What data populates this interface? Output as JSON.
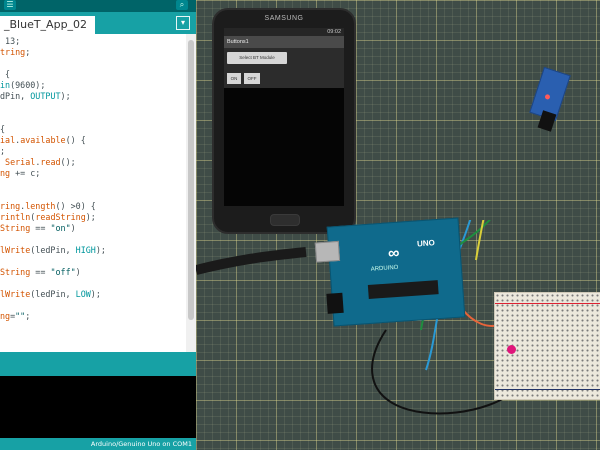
{
  "ide": {
    "toolbar": {
      "serial_monitor_icon": "magnifier-icon"
    },
    "tab": {
      "label": "_BlueT_App_02"
    },
    "tab_menu": "▾",
    "code_lines": [
      " 13;",
      "tring;",
      "",
      " {",
      "in(9600);",
      "dPin, OUTPUT);",
      "",
      "",
      "{",
      "ial.available() {",
      ";",
      " Serial.read();",
      "ng += c;",
      "",
      "",
      "ring.length() >0) {",
      "rintln(readString);",
      "String == \"on\")",
      "",
      "lWrite(ledPin, HIGH);",
      "",
      "String == \"off\")",
      "",
      "lWrite(ledPin, LOW);",
      "",
      "ng=\"\";"
    ],
    "status_bar": "Arduino/Genuino Uno on COM1"
  },
  "phone": {
    "brand": "SAMSUNG",
    "status_time": "09:02",
    "app_title": "Buttons1",
    "select_button": "Select BT Module",
    "on_button": "ON",
    "off_button": "OFF"
  },
  "board": {
    "logo": "∞",
    "label": "ARDUINO",
    "model": "UNO"
  },
  "colors": {
    "ide_teal": "#17a1a5",
    "ide_dark": "#006468",
    "keyword": "#d35400",
    "builtin": "#00979d",
    "mat": "#3f4c47",
    "led": "#e0157a"
  }
}
